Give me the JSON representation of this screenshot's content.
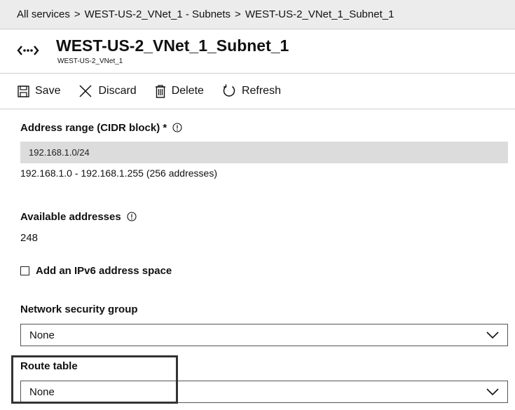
{
  "breadcrumb": {
    "items": [
      "All services",
      "WEST-US-2_VNet_1 - Subnets",
      "WEST-US-2_VNet_1_Subnet_1"
    ],
    "separator": ">"
  },
  "header": {
    "icon": "subnet-icon",
    "title": "WEST-US-2_VNet_1_Subnet_1",
    "subtitle": "WEST-US-2_VNet_1"
  },
  "toolbar": {
    "save_label": "Save",
    "discard_label": "Discard",
    "delete_label": "Delete",
    "refresh_label": "Refresh"
  },
  "address_range": {
    "label": "Address range (CIDR block) *",
    "value": "192.168.1.0/24",
    "range_text": "192.168.1.0 - 192.168.1.255 (256 addresses)"
  },
  "available_addresses": {
    "label": "Available addresses",
    "value": "248"
  },
  "ipv6": {
    "label": "Add an IPv6 address space",
    "checked": false
  },
  "network_security_group": {
    "label": "Network security group",
    "selected": "None"
  },
  "route_table": {
    "label": "Route table",
    "selected": "None"
  }
}
